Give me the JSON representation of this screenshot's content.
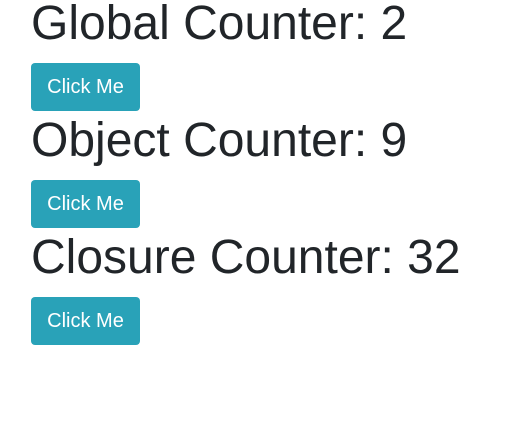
{
  "counters": [
    {
      "title": "Global Counter: 2",
      "button_label": "Click Me"
    },
    {
      "title": "Object Counter: 9",
      "button_label": "Click Me"
    },
    {
      "title": "Closure Counter: 32",
      "button_label": "Click Me"
    }
  ],
  "colors": {
    "button_bg": "#29a2b8",
    "button_text": "#ffffff",
    "heading_text": "#212529"
  }
}
